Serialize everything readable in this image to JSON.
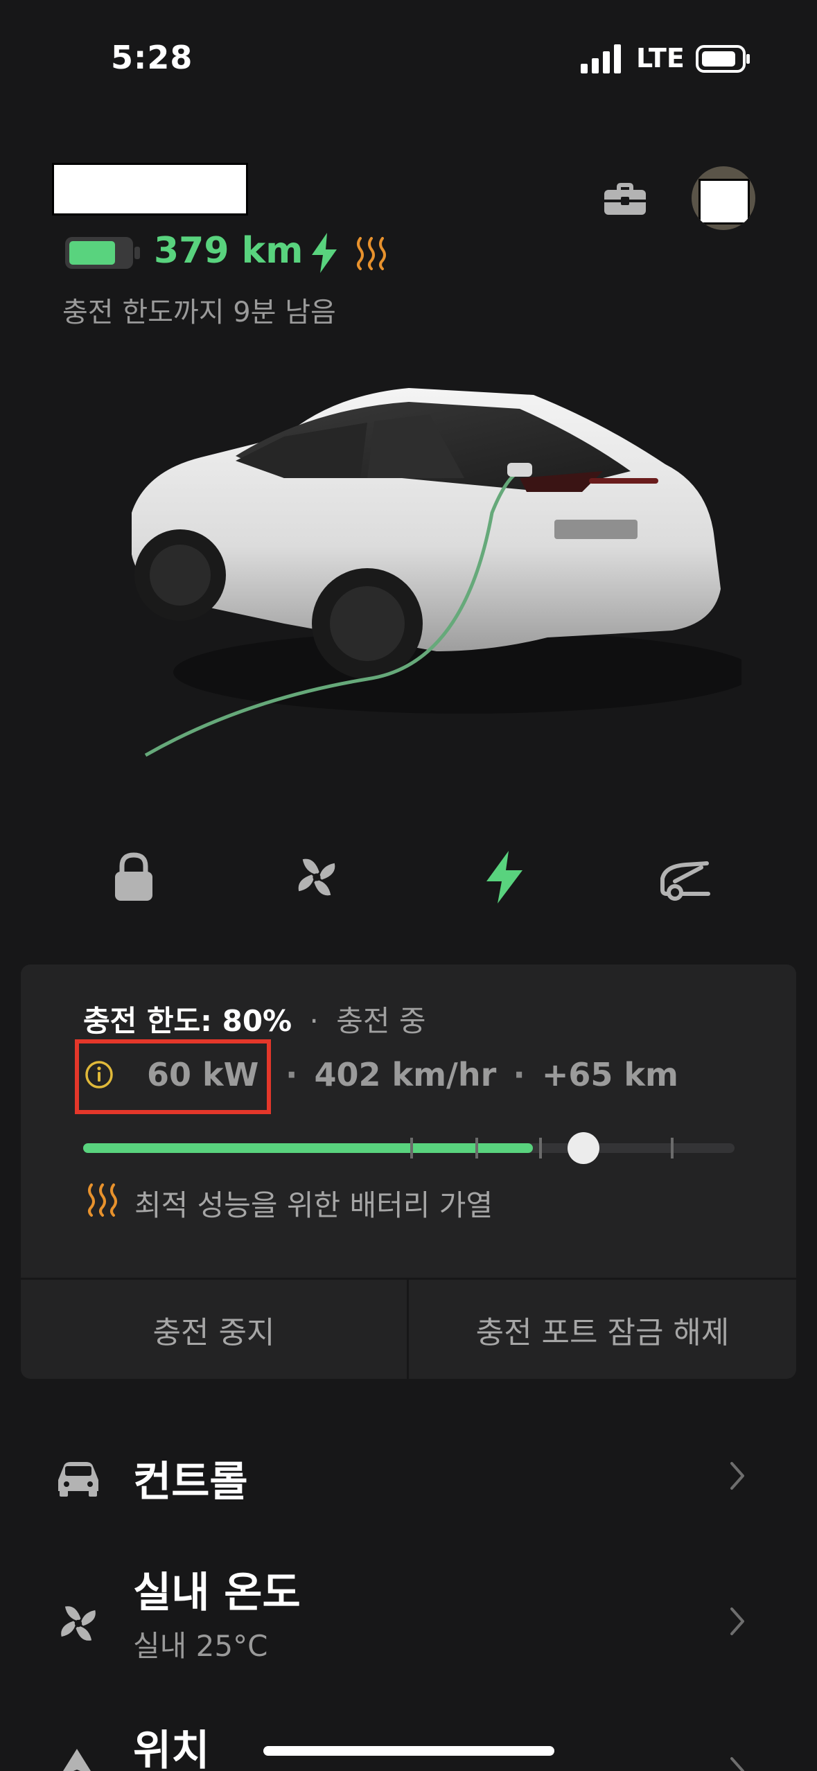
{
  "status_bar": {
    "time": "5:28",
    "network": "LTE"
  },
  "header": {
    "range": "379 km",
    "subtitle": "충전 한도까지 9분 남음"
  },
  "quick_controls": [
    "lock-icon",
    "fan-icon",
    "charge-bolt-icon",
    "frunk-icon"
  ],
  "charge_card": {
    "limit_label": "충전 한도: 80%",
    "separator": "·",
    "state": "충전 중",
    "power": "60 kW",
    "rate": "402 km/hr",
    "added": "+65 km",
    "progress_fraction": 0.69,
    "limit_fraction": 0.8,
    "warming_text": "최적 성능을 위한 배터리 가열",
    "stop_button": "충전 중지",
    "unlock_port_button": "충전 포트 잠금 해제"
  },
  "menu": {
    "controls": {
      "title": "컨트롤"
    },
    "climate": {
      "title": "실내 온도",
      "subtitle": "실내 25°C"
    },
    "location": {
      "title": "위치"
    }
  },
  "colors": {
    "accent_green": "#59d37e",
    "heat_orange": "#e8922d",
    "annotation_red": "#e4372a",
    "background": "#171718",
    "card": "#232324"
  }
}
